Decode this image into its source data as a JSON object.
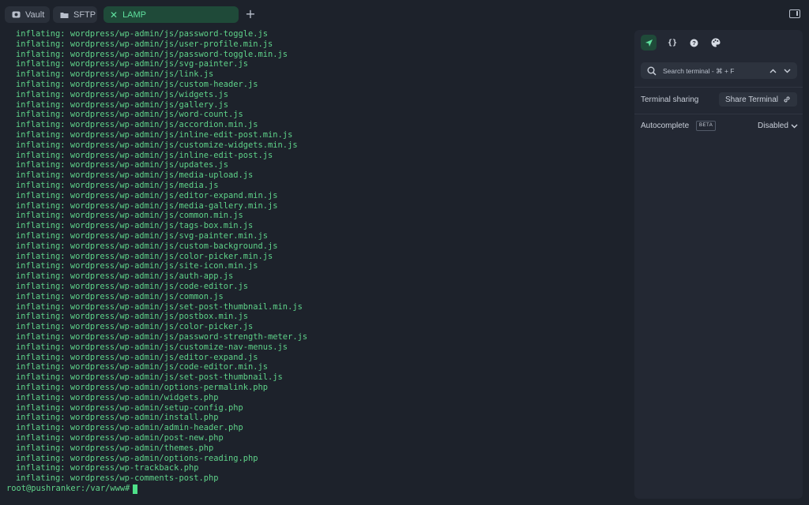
{
  "tabs": [
    {
      "label": "Vault",
      "icon": "vault-icon"
    },
    {
      "label": "SFTP",
      "icon": "folder-icon"
    },
    {
      "label": "LAMP",
      "icon": "close-icon",
      "active": true
    }
  ],
  "terminal": {
    "lines": [
      "inflating: wordpress/wp-admin/js/password-toggle.js",
      "inflating: wordpress/wp-admin/js/user-profile.min.js",
      "inflating: wordpress/wp-admin/js/password-toggle.min.js",
      "inflating: wordpress/wp-admin/js/svg-painter.js",
      "inflating: wordpress/wp-admin/js/link.js",
      "inflating: wordpress/wp-admin/js/custom-header.js",
      "inflating: wordpress/wp-admin/js/widgets.js",
      "inflating: wordpress/wp-admin/js/gallery.js",
      "inflating: wordpress/wp-admin/js/word-count.js",
      "inflating: wordpress/wp-admin/js/accordion.min.js",
      "inflating: wordpress/wp-admin/js/inline-edit-post.min.js",
      "inflating: wordpress/wp-admin/js/customize-widgets.min.js",
      "inflating: wordpress/wp-admin/js/inline-edit-post.js",
      "inflating: wordpress/wp-admin/js/updates.js",
      "inflating: wordpress/wp-admin/js/media-upload.js",
      "inflating: wordpress/wp-admin/js/media.js",
      "inflating: wordpress/wp-admin/js/editor-expand.min.js",
      "inflating: wordpress/wp-admin/js/media-gallery.min.js",
      "inflating: wordpress/wp-admin/js/common.min.js",
      "inflating: wordpress/wp-admin/js/tags-box.min.js",
      "inflating: wordpress/wp-admin/js/svg-painter.min.js",
      "inflating: wordpress/wp-admin/js/custom-background.js",
      "inflating: wordpress/wp-admin/js/color-picker.min.js",
      "inflating: wordpress/wp-admin/js/site-icon.min.js",
      "inflating: wordpress/wp-admin/js/auth-app.js",
      "inflating: wordpress/wp-admin/js/code-editor.js",
      "inflating: wordpress/wp-admin/js/common.js",
      "inflating: wordpress/wp-admin/js/set-post-thumbnail.min.js",
      "inflating: wordpress/wp-admin/js/postbox.min.js",
      "inflating: wordpress/wp-admin/js/color-picker.js",
      "inflating: wordpress/wp-admin/js/password-strength-meter.js",
      "inflating: wordpress/wp-admin/js/customize-nav-menus.js",
      "inflating: wordpress/wp-admin/js/editor-expand.js",
      "inflating: wordpress/wp-admin/js/code-editor.min.js",
      "inflating: wordpress/wp-admin/js/set-post-thumbnail.js",
      "inflating: wordpress/wp-admin/options-permalink.php",
      "inflating: wordpress/wp-admin/widgets.php",
      "inflating: wordpress/wp-admin/setup-config.php",
      "inflating: wordpress/wp-admin/install.php",
      "inflating: wordpress/wp-admin/admin-header.php",
      "inflating: wordpress/wp-admin/post-new.php",
      "inflating: wordpress/wp-admin/themes.php",
      "inflating: wordpress/wp-admin/options-reading.php",
      "inflating: wordpress/wp-trackback.php",
      "inflating: wordpress/wp-comments-post.php"
    ],
    "prompt": "root@pushranker:/var/www#"
  },
  "sidepanel": {
    "icons": [
      "send-icon",
      "braces-icon",
      "help-icon",
      "palette-icon"
    ],
    "search_placeholder": "Search terminal - ⌘ + F",
    "terminal_sharing_label": "Terminal sharing",
    "share_button_label": "Share Terminal",
    "autocomplete_label": "Autocomplete",
    "beta_badge": "BETA",
    "autocomplete_value": "Disabled"
  },
  "colors": {
    "background": "#1d222b",
    "terminal_text": "#5fd38a",
    "accent": "#5fe09e",
    "active_tab_bg": "#1f4a39",
    "panel_bg": "#232833"
  }
}
